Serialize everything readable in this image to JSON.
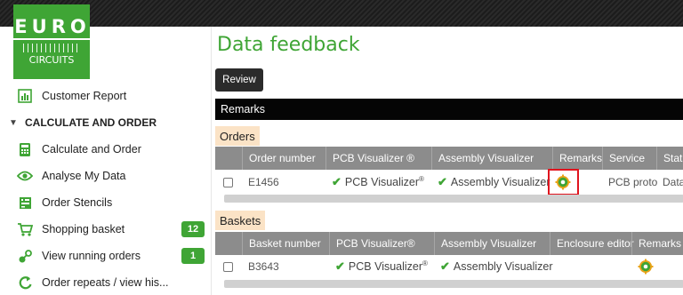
{
  "sidebar": {
    "logo": {
      "line1": "EURO",
      "line2": "CIRCUITS"
    },
    "items": [
      {
        "label": "Customer Report",
        "icon": "report-icon"
      },
      {
        "label": "CALCULATE AND ORDER",
        "icon": "caret-down-icon"
      },
      {
        "label": "Calculate and Order",
        "icon": "calculator-icon"
      },
      {
        "label": "Analyse My Data",
        "icon": "eye-icon"
      },
      {
        "label": "Order Stencils",
        "icon": "stencil-icon"
      },
      {
        "label": "Shopping basket",
        "icon": "cart-icon",
        "badge": "12"
      },
      {
        "label": "View running orders",
        "icon": "running-orders-icon",
        "badge": "1"
      },
      {
        "label": "Order repeats / view his...",
        "icon": "repeat-icon"
      }
    ]
  },
  "main": {
    "title": "Data feedback",
    "review_button": "Review",
    "remarks_header": "Remarks",
    "orders": {
      "label": "Orders",
      "columns": [
        "Order number",
        "PCB Visualizer ®",
        "Assembly Visualizer",
        "Remarks",
        "Service",
        "Stat"
      ],
      "rows": [
        {
          "order_number": "E1456",
          "pcb_visualizer": "PCB Visualizer",
          "pcb_sup": "®",
          "assembly_visualizer": "Assembly Visualizer",
          "service": "PCB proto",
          "status": "Data"
        }
      ]
    },
    "baskets": {
      "label": "Baskets",
      "columns": [
        "Basket number",
        "PCB Visualizer®",
        "Assembly Visualizer",
        "Enclosure editor",
        "Remarks"
      ],
      "rows": [
        {
          "basket_number": "B3643",
          "pcb_visualizer": "PCB Visualizer",
          "pcb_sup": "®",
          "assembly_visualizer": "Assembly Visualizer"
        }
      ]
    }
  },
  "colors": {
    "brand_green": "#3fa535",
    "header_gray": "#8c8c8c",
    "section_bg": "#fbe3c6",
    "highlight_red": "#e0141e"
  }
}
